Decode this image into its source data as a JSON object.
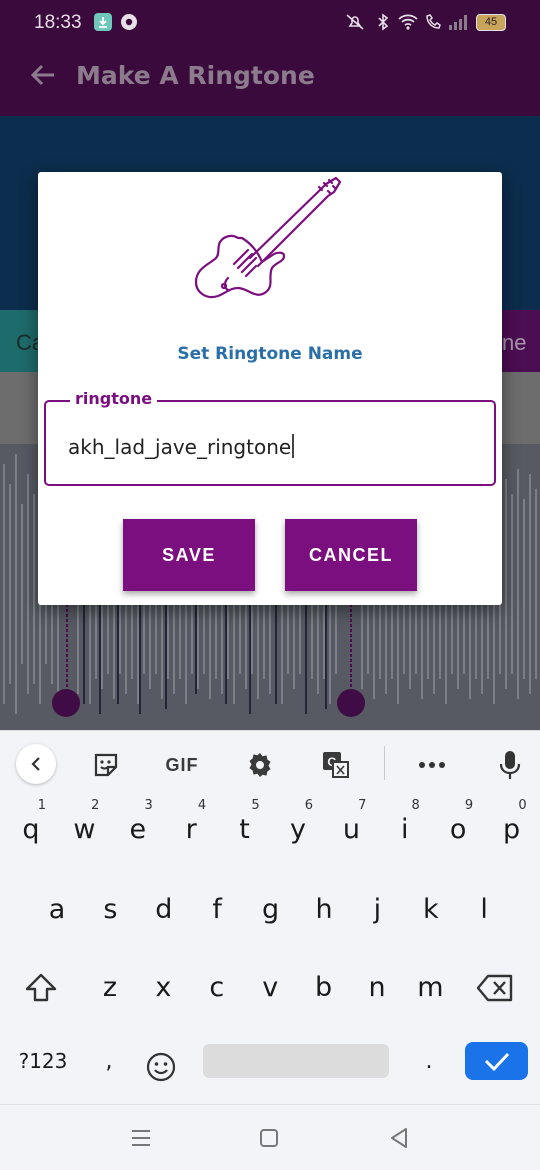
{
  "status_bar": {
    "time": "18:33",
    "battery": "45"
  },
  "app_bar": {
    "title": "Make A Ringtone",
    "back_icon": "arrow-back-icon"
  },
  "background_tabs": {
    "left_fragment": "Ca",
    "right_fragment": "ne"
  },
  "dialog": {
    "icon": "guitar-icon",
    "title": "Set Ringtone Name",
    "field_label": "ringtone",
    "field_value": "akh_lad_jave_ringtone",
    "save_label": "SAVE",
    "cancel_label": "CANCEL"
  },
  "keyboard": {
    "toolbar": {
      "gif_label": "GIF"
    },
    "row1": [
      {
        "k": "q",
        "n": "1"
      },
      {
        "k": "w",
        "n": "2"
      },
      {
        "k": "e",
        "n": "3"
      },
      {
        "k": "r",
        "n": "4"
      },
      {
        "k": "t",
        "n": "5"
      },
      {
        "k": "y",
        "n": "6"
      },
      {
        "k": "u",
        "n": "7"
      },
      {
        "k": "i",
        "n": "8"
      },
      {
        "k": "o",
        "n": "9"
      },
      {
        "k": "p",
        "n": "0"
      }
    ],
    "row2": [
      "a",
      "s",
      "d",
      "f",
      "g",
      "h",
      "j",
      "k",
      "l"
    ],
    "row3": [
      "z",
      "x",
      "c",
      "v",
      "b",
      "n",
      "m"
    ],
    "symbols_label": "?123",
    "comma": ",",
    "period": "."
  },
  "colors": {
    "accent": "#7b0f80",
    "title_blue": "#2b6fa8",
    "enter_blue": "#1a73e8"
  }
}
